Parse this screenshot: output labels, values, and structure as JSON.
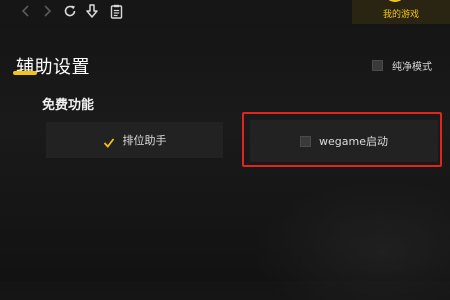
{
  "toolbar": {
    "back_icon": "chevron-left",
    "forward_icon": "chevron-right",
    "refresh_icon": "refresh",
    "download_icon": "download",
    "notes_icon": "clipboard"
  },
  "my_games": {
    "label": "我的游戏",
    "accent_color": "#f3c316"
  },
  "page": {
    "title": "辅助设置"
  },
  "pure_mode": {
    "label": "纯净模式",
    "checked": false
  },
  "free_features": {
    "heading": "免费功能",
    "items": [
      {
        "label": "排位助手",
        "checked": true
      },
      {
        "label": "wegame启动",
        "checked": false
      }
    ]
  },
  "colors": {
    "highlight": "#e0251d",
    "check": "#f3c316"
  }
}
